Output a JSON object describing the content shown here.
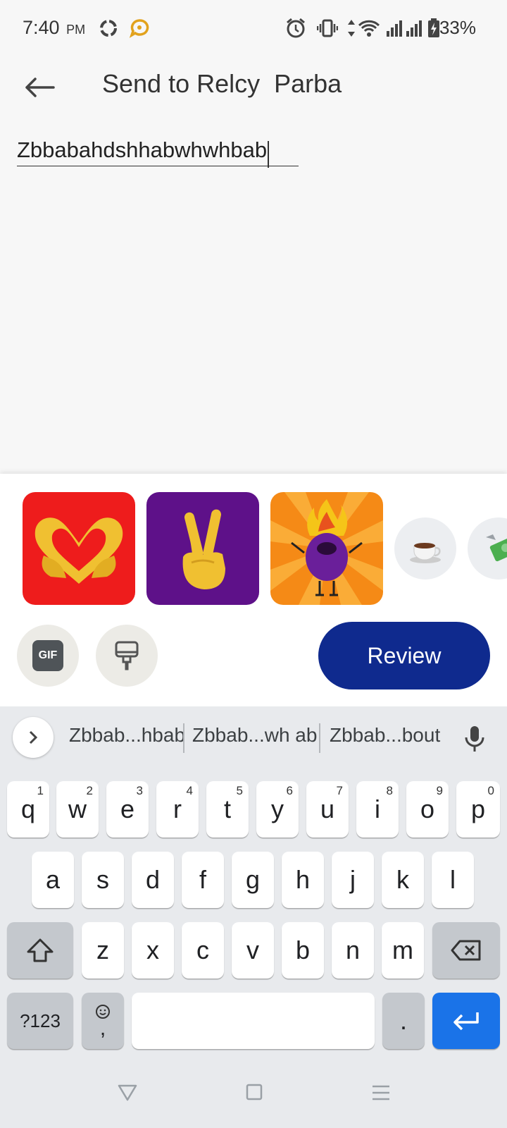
{
  "status_bar": {
    "time": "7:40",
    "ampm": "PM",
    "battery_percent": "33%",
    "icons": [
      "sync-icon",
      "chat-bubble-icon",
      "alarm-icon",
      "vibrate-icon",
      "data-arrows-icon",
      "wifi-icon",
      "signal-icon",
      "signal-icon",
      "battery-charging-icon"
    ]
  },
  "header": {
    "title": "Send to Relcy  Parba",
    "back_icon": "arrow-left-icon"
  },
  "message": {
    "text": "Zbbabahdshhabwhwhbab"
  },
  "stickers": [
    {
      "name": "heart-hands-sticker",
      "bg": "#ee1c1c"
    },
    {
      "name": "victory-hand-sticker",
      "bg": "#5e1189"
    },
    {
      "name": "flaming-purple-character-sticker",
      "bg": "#f58a16"
    },
    {
      "name": "coffee-cup-sticker"
    },
    {
      "name": "money-sticker"
    }
  ],
  "actions": {
    "gif_label": "GIF",
    "review_label": "Review",
    "review_color": "#0f2a8e"
  },
  "keyboard": {
    "suggestions": [
      "Zbbab...hbab",
      "Zbbab...wh ab",
      "Zbbab...bout"
    ],
    "row1": [
      "q",
      "w",
      "e",
      "r",
      "t",
      "y",
      "u",
      "i",
      "o",
      "p"
    ],
    "row1_hints": [
      "1",
      "2",
      "3",
      "4",
      "5",
      "6",
      "7",
      "8",
      "9",
      "0"
    ],
    "row2": [
      "a",
      "s",
      "d",
      "f",
      "g",
      "h",
      "j",
      "k",
      "l"
    ],
    "row3": [
      "z",
      "x",
      "c",
      "v",
      "b",
      "n",
      "m"
    ],
    "symbols_label": "?123",
    "comma_label": ",",
    "period_label": ".",
    "enter_color": "#1a73e8"
  },
  "nav_bar": {
    "icons": [
      "back-triangle-icon",
      "home-square-icon",
      "recents-menu-icon"
    ]
  }
}
